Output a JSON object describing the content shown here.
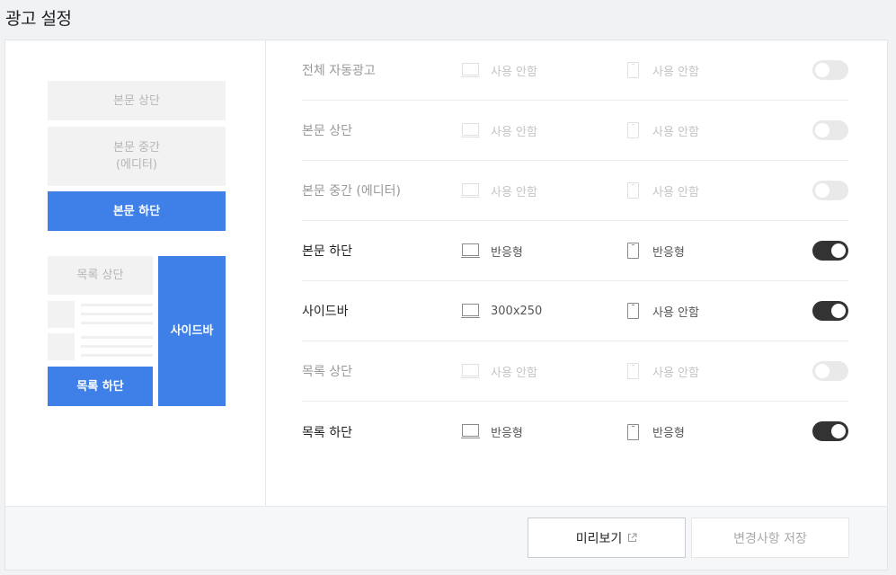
{
  "page_title": "광고 설정",
  "preview": {
    "top": "본문 상단",
    "middle_line1": "본문 중간",
    "middle_line2": "(에디터)",
    "bottom": "본문 하단",
    "list_top": "목록 상단",
    "list_bottom": "목록 하단",
    "sidebar": "사이드바"
  },
  "rows": [
    {
      "label": "전체 자동광고",
      "pc": "사용 안함",
      "mobile": "사용 안함",
      "enabled": false
    },
    {
      "label": "본문 상단",
      "pc": "사용 안함",
      "mobile": "사용 안함",
      "enabled": false
    },
    {
      "label": "본문 중간 (에디터)",
      "pc": "사용 안함",
      "mobile": "사용 안함",
      "enabled": false
    },
    {
      "label": "본문 하단",
      "pc": "반응형",
      "mobile": "반응형",
      "enabled": true
    },
    {
      "label": "사이드바",
      "pc": "300x250",
      "mobile": "사용 안함",
      "enabled": true
    },
    {
      "label": "목록 상단",
      "pc": "사용 안함",
      "mobile": "사용 안함",
      "enabled": false
    },
    {
      "label": "목록 하단",
      "pc": "반응형",
      "mobile": "반응형",
      "enabled": true
    }
  ],
  "icons": {
    "pc": "desktop-monitor-icon",
    "mobile": "mobile-phone-icon",
    "external": "external-link-icon"
  },
  "footer": {
    "preview_label": "미리보기",
    "save_label": "변경사항 저장"
  },
  "colors": {
    "accent": "#3f80e8",
    "toggle_on": "#333333",
    "toggle_off": "#e9e9e9"
  }
}
